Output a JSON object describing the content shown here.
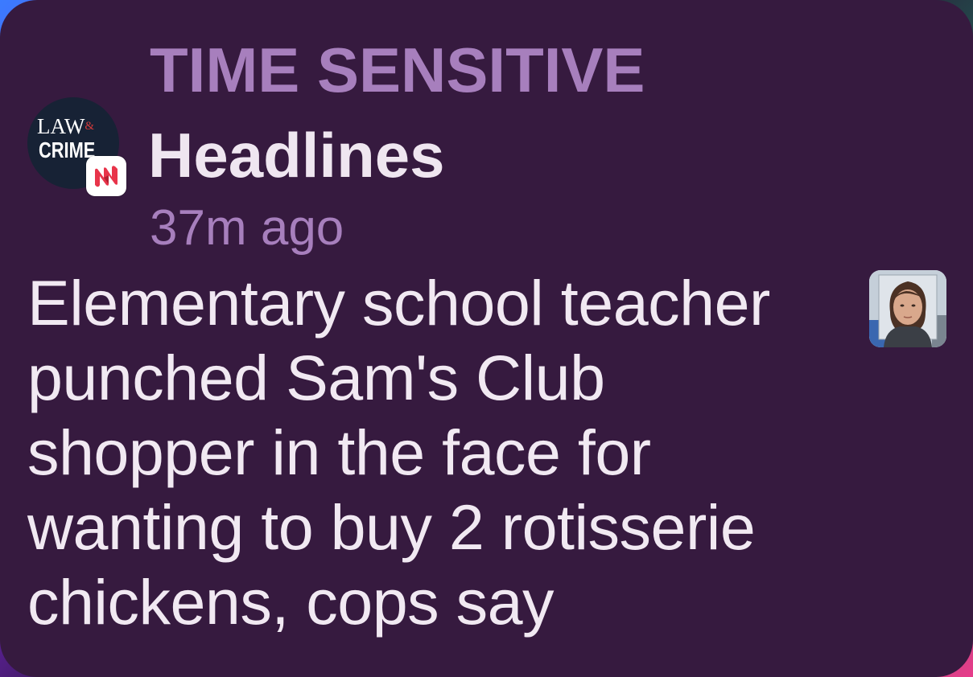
{
  "notification": {
    "category": "TIME SENSITIVE",
    "app_name": "Headlines",
    "timestamp": "37m ago",
    "body": "Elementary school teacher\npunched Sam's Club\nshopper in the face for\nwanting to buy 2 rotisserie\nchickens, cops say",
    "app_icon": {
      "name": "law-and-crime-logo",
      "line1": "LAW",
      "amp": "&",
      "line2": "CRIME"
    },
    "badge_icon": "news-app-icon",
    "thumbnail_icon": "mugshot-thumbnail"
  },
  "colors": {
    "background": "#361a3f",
    "accent": "#a77fbd",
    "text": "#f1e9f2",
    "news_red": "#e8344a"
  }
}
